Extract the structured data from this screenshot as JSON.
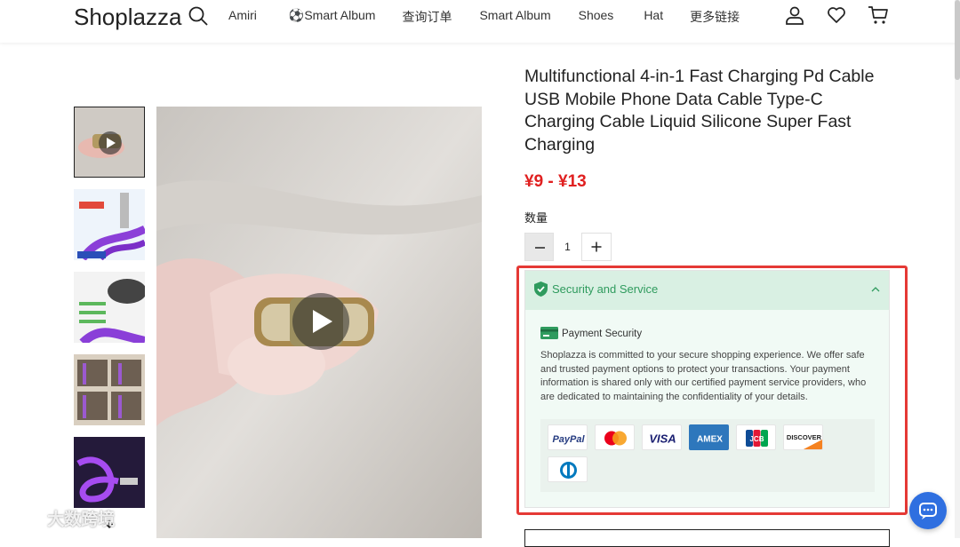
{
  "header": {
    "logo": "Shoplazza",
    "nav": [
      "Amiri",
      "⚽Smart Album",
      "查询订单",
      "Smart Album",
      "Shoes",
      "Hat",
      "更多链接"
    ],
    "icons": [
      "search-icon",
      "account-icon",
      "wishlist-icon",
      "cart-icon"
    ]
  },
  "product": {
    "title": "Multifunctional 4-in-1 Fast Charging Pd Cable USB Mobile Phone Data Cable Type-C Charging Cable Liquid Silicone Super Fast Charging",
    "price": "¥9 - ¥13",
    "quantity_label": "数量",
    "quantity_value": "1"
  },
  "security": {
    "title": "Security and Service",
    "payment_title": "Payment Security",
    "payment_desc": "Shoplazza is committed to your secure shopping experience. We offer safe and trusted payment options to protect your transactions. Your payment information is shared only with our certified payment service providers, who are dedicated to maintaining the confidentiality of your details.",
    "cards": [
      "PayPal",
      "Mastercard",
      "VISA",
      "AMEX",
      "JCB",
      "DISCOVER",
      "Diners Club"
    ]
  },
  "watermark": "大数跨境",
  "colors": {
    "price": "#e02020",
    "security_green": "#2f9b5e",
    "highlight_outline": "#e53935",
    "chat": "#2f6fe0"
  }
}
